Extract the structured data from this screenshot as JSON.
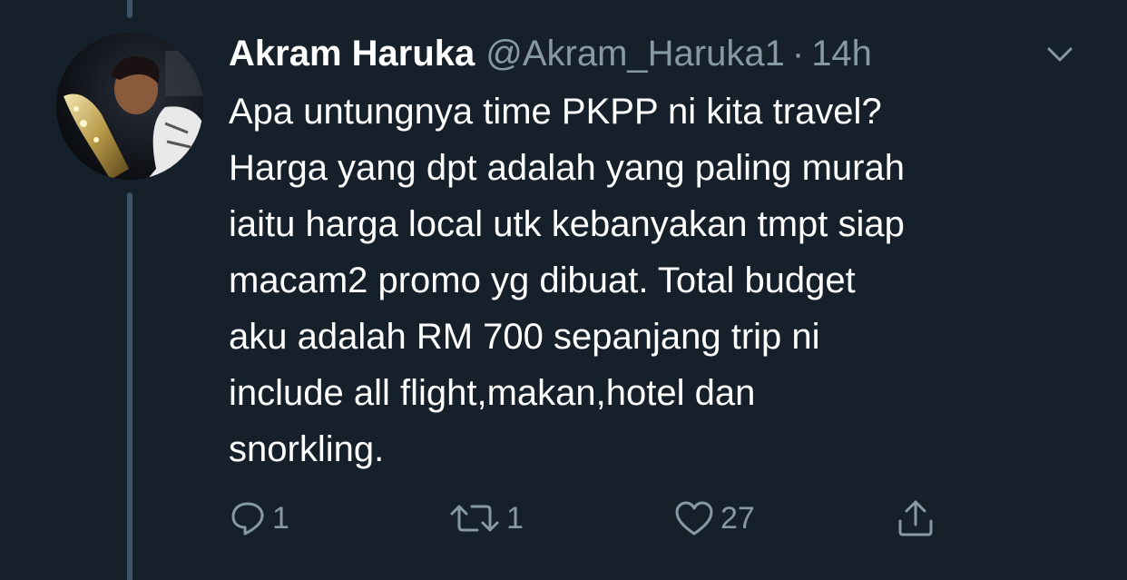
{
  "tweet": {
    "display_name": "Akram Haruka",
    "handle": "@Akram_Haruka1",
    "separator": "·",
    "time": "14h",
    "text": "Apa untungnya time PKPP ni kita travel?\nHarga yang dpt adalah yang paling murah\niaitu harga local utk kebanyakan tmpt siap\nmacam2 promo yg dibuat. Total budget\naku adalah RM 700 sepanjang trip ni\ninclude all flight,makan,hotel dan\nsnorkling."
  },
  "actions": {
    "reply_count": "1",
    "retweet_count": "1",
    "like_count": "27"
  },
  "icons": {
    "reply": "reply-icon",
    "retweet": "retweet-icon",
    "like": "heart-icon",
    "share": "share-icon",
    "more": "chevron-down-icon"
  },
  "colors": {
    "background": "#15202b",
    "secondary_text": "#8899a6",
    "thread_line": "#3d5466"
  }
}
